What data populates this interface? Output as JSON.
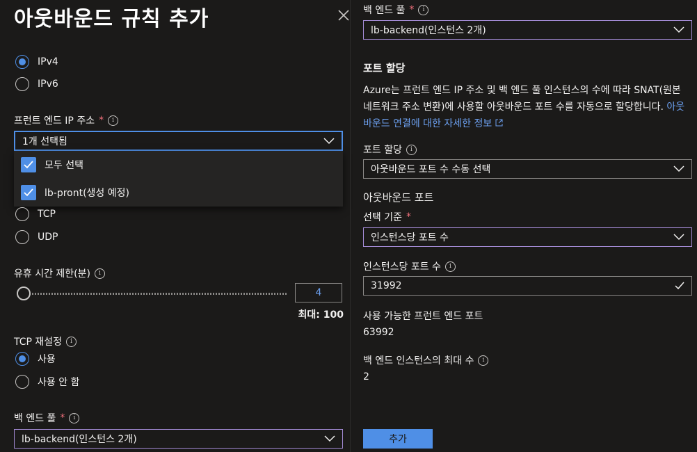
{
  "left": {
    "title": "아웃바운드 규칙 추가",
    "ip_version": {
      "options": [
        "IPv4",
        "IPv6"
      ],
      "selected": "IPv4"
    },
    "frontend_ip": {
      "label": "프런트 엔드 IP 주소",
      "required": "*",
      "value": "1개 선택됨",
      "dropdown_items": [
        {
          "label": "모두 선택",
          "checked": true
        },
        {
          "label": "lb-pront(생성 예정)",
          "checked": true
        }
      ]
    },
    "protocol": {
      "options": [
        "TCP",
        "UDP"
      ]
    },
    "idle_timeout": {
      "label": "유휴 시간 제한(분)",
      "value": "4",
      "level": 0.0,
      "max_text": "최대: 100"
    },
    "tcp_reset": {
      "label": "TCP 재설정",
      "options": [
        "사용",
        "사용 안 함"
      ],
      "selected": "사용"
    },
    "backend_pool": {
      "label": "백 엔드 풀",
      "required": "*",
      "value": "lb-backend(인스턴스 2개)"
    }
  },
  "right": {
    "backend_pool": {
      "label": "백 엔드 풀",
      "required": "*",
      "value": "lb-backend(인스턴스 2개)"
    },
    "port_allocation_header": "포트 할당",
    "description_text": "Azure는 프런트 엔드 IP 주소 및 백 엔드 풀 인스턴스의 수에 따라 SNAT(원본 네트워크 주소 변환)에 사용할 아웃바운드 포트 수를 자동으로 할당합니다.",
    "learn_more_link": "아웃바운드 연결에 대한 자세한 정보",
    "port_allocation": {
      "label": "포트 할당",
      "value": "아웃바운드 포트 수 수동 선택"
    },
    "outbound_ports_header": "아웃바운드 포트",
    "selection_basis": {
      "label": "선택 기준",
      "required": "*",
      "value": "인스턴스당 포트 수"
    },
    "ports_per_instance": {
      "label": "인스턴스당 포트 수",
      "value": "31992"
    },
    "available_frontend_ports": {
      "label": "사용 가능한 프런트 엔드 포트",
      "value": "63992"
    },
    "max_backend_instances": {
      "label": "백 엔드 인스턴스의 최대 수",
      "value": "2"
    },
    "add_button": "추가"
  },
  "colors": {
    "background": "#1b1a19",
    "accent": "#4f8fe6",
    "input_border": "#a48bd6",
    "link": "#6ca0f0",
    "required": "#f1707b"
  }
}
